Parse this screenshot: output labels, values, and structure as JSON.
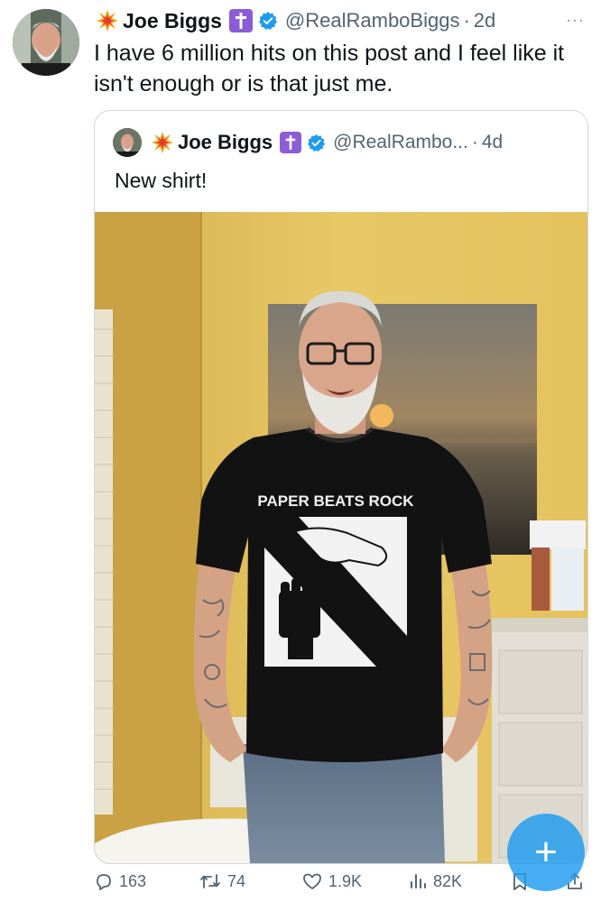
{
  "post": {
    "author_name": "Joe Biggs",
    "handle": "@RealRamboBiggs",
    "separator": "·",
    "time": "2d",
    "more": "···",
    "text": "I have 6 million hits on this post and I feel like it isn't enough or is that just me."
  },
  "quote": {
    "author_name": "Joe Biggs",
    "handle": "@RealRambo...",
    "separator": "·",
    "time": "4d",
    "text": "New shirt!",
    "shirt_text": "PAPER BEATS ROCK"
  },
  "actions": {
    "replies": "163",
    "reposts": "74",
    "likes": "1.9K",
    "views": "82K"
  },
  "fab": {
    "label": "+"
  },
  "colors": {
    "accent": "#1d9bf0",
    "badge_purple": "#8b5cd6",
    "text_secondary": "#536471"
  }
}
